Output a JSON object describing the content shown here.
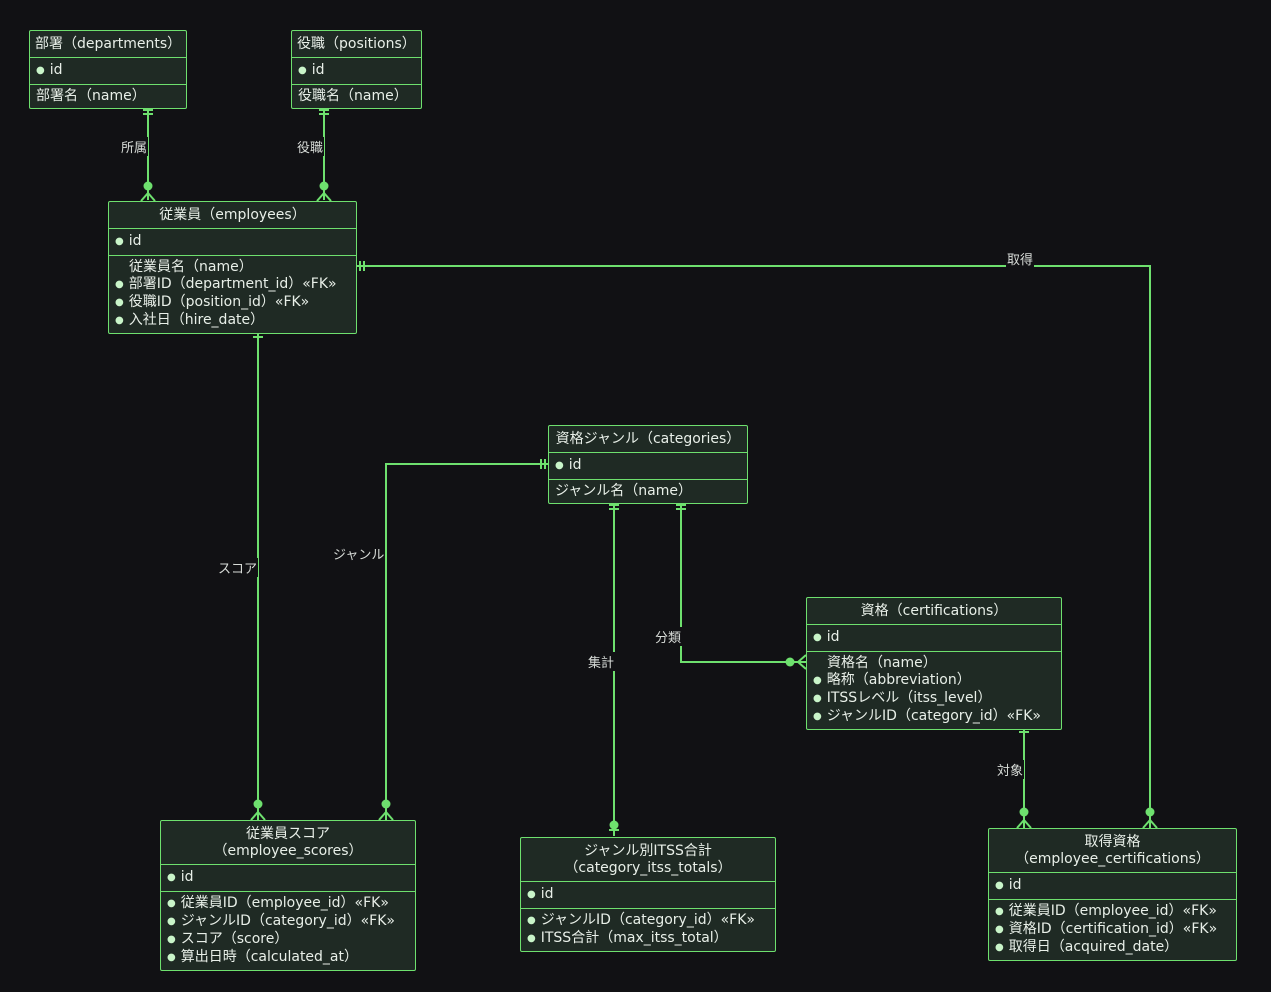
{
  "colors": {
    "line": "#6ee06e",
    "box": "#1f2a24",
    "background": "#111114"
  },
  "entities": {
    "departments": {
      "title": "部署（departments）",
      "pk": "id",
      "attrs": [
        "部署名（name）"
      ]
    },
    "positions": {
      "title": "役職（positions）",
      "pk": "id",
      "attrs": [
        "役職名（name）"
      ]
    },
    "employees": {
      "title": "従業員（employees）",
      "pk": "id",
      "attrs": [
        "従業員名（name）",
        "部署ID（department_id）«FK»",
        "役職ID（position_id）«FK»",
        "入社日（hire_date）"
      ]
    },
    "categories": {
      "title": "資格ジャンル（categories）",
      "pk": "id",
      "attrs": [
        "ジャンル名（name）"
      ]
    },
    "certifications": {
      "title": "資格（certifications）",
      "pk": "id",
      "attrs": [
        "資格名（name）",
        "略称（abbreviation）",
        "ITSSレベル（itss_level）",
        "ジャンルID（category_id）«FK»"
      ]
    },
    "employee_scores": {
      "title": "従業員スコア\n（employee_scores）",
      "pk": "id",
      "attrs": [
        "従業員ID（employee_id）«FK»",
        "ジャンルID（category_id）«FK»",
        "スコア（score）",
        "算出日時（calculated_at）"
      ]
    },
    "category_itss_totals": {
      "title": "ジャンル別ITSS合計\n（category_itss_totals）",
      "pk": "id",
      "attrs": [
        "ジャンルID（category_id）«FK»",
        "ITSS合計（max_itss_total）"
      ]
    },
    "employee_certifications": {
      "title": "取得資格\n（employee_certifications）",
      "pk": "id",
      "attrs": [
        "従業員ID（employee_id）«FK»",
        "資格ID（certification_id）«FK»",
        "取得日（acquired_date）"
      ]
    }
  },
  "relations": {
    "belongs": "所属",
    "position": "役職",
    "acquire": "取得",
    "score": "スコア",
    "genre": "ジャンル",
    "aggregate": "集計",
    "classify": "分類",
    "target": "対象"
  }
}
